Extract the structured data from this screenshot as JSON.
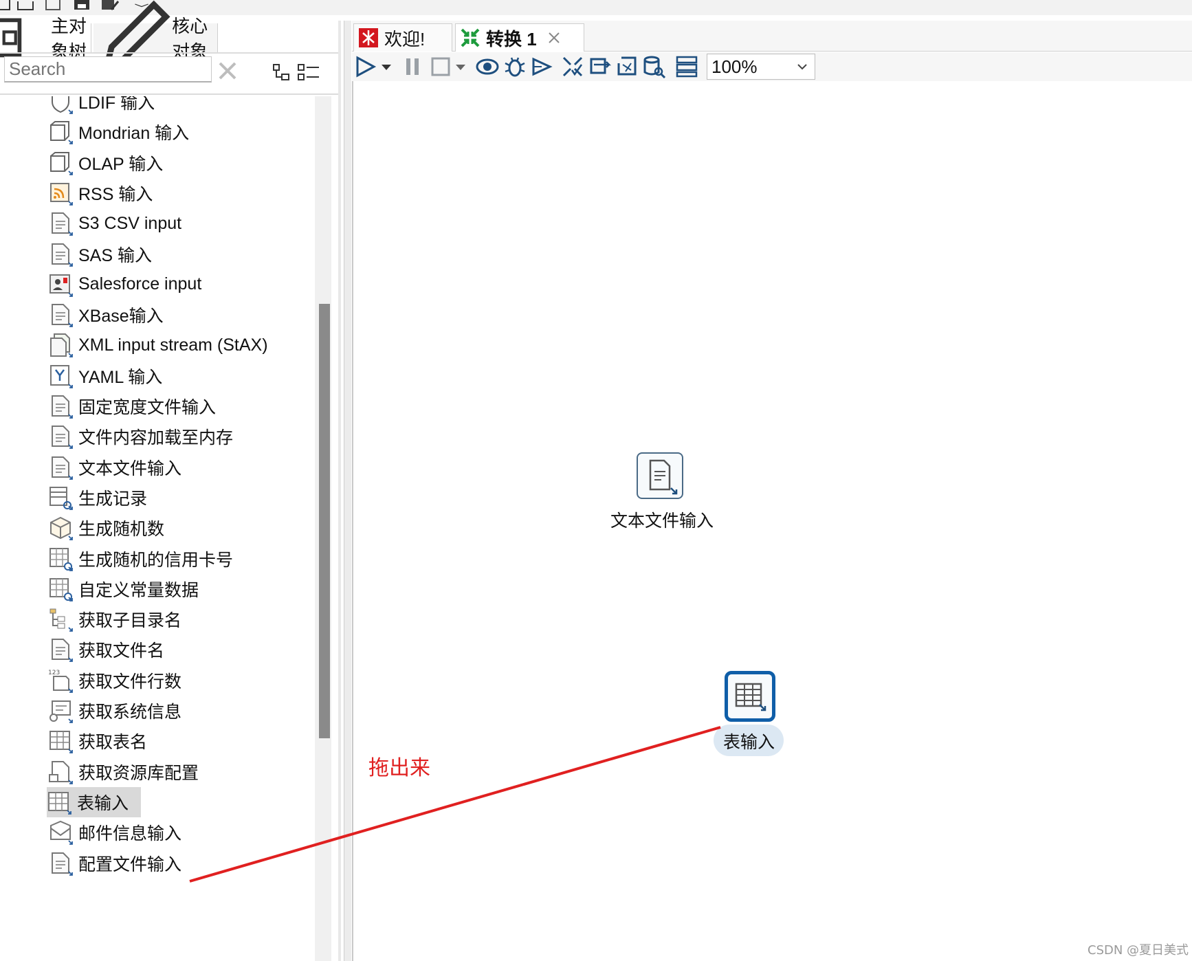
{
  "left_panel": {
    "tabs": [
      {
        "label": "主对象树",
        "icon": "tree-icon"
      },
      {
        "label": "核心对象",
        "icon": "pencil-icon"
      }
    ],
    "search": {
      "placeholder": "Search",
      "value": ""
    },
    "tree_items": [
      {
        "label": "LDIF 输入",
        "icon": "ldif-icon"
      },
      {
        "label": "Mondrian 输入",
        "icon": "cube-icon"
      },
      {
        "label": "OLAP 输入",
        "icon": "cube-icon"
      },
      {
        "label": "RSS 输入",
        "icon": "rss-icon"
      },
      {
        "label": "S3 CSV input",
        "icon": "s3-file-icon"
      },
      {
        "label": "SAS 输入",
        "icon": "sas-file-icon"
      },
      {
        "label": "Salesforce input",
        "icon": "salesforce-icon"
      },
      {
        "label": "XBase输入",
        "icon": "dbf-file-icon"
      },
      {
        "label": "XML input stream (StAX)",
        "icon": "xml-file-icon"
      },
      {
        "label": "YAML 输入",
        "icon": "yaml-icon"
      },
      {
        "label": "固定宽度文件输入",
        "icon": "file-icon"
      },
      {
        "label": "文件内容加载至内存",
        "icon": "file-icon"
      },
      {
        "label": "文本文件输入",
        "icon": "file-icon"
      },
      {
        "label": "生成记录",
        "icon": "generate-rows-icon"
      },
      {
        "label": "生成随机数",
        "icon": "dice-icon"
      },
      {
        "label": "生成随机的信用卡号",
        "icon": "credit-card-icon"
      },
      {
        "label": "自定义常量数据",
        "icon": "table-gear-icon"
      },
      {
        "label": "获取子目录名",
        "icon": "folder-tree-icon"
      },
      {
        "label": "获取文件名",
        "icon": "file-icon"
      },
      {
        "label": "获取文件行数",
        "icon": "file-rows-icon"
      },
      {
        "label": "获取系统信息",
        "icon": "system-info-icon"
      },
      {
        "label": "获取表名",
        "icon": "table-icon"
      },
      {
        "label": "获取资源库配置",
        "icon": "repository-icon"
      },
      {
        "label": "表输入",
        "icon": "table-icon",
        "selected": true
      },
      {
        "label": "邮件信息输入",
        "icon": "mail-icon"
      },
      {
        "label": "配置文件输入",
        "icon": "config-file-icon"
      }
    ]
  },
  "editor": {
    "tabs": [
      {
        "label": "欢迎!",
        "icon": "welcome-icon",
        "active": false
      },
      {
        "label": "转换 1",
        "icon": "transformation-icon",
        "active": true,
        "closable": true
      }
    ],
    "zoom": "100%",
    "canvas_steps": [
      {
        "label": "文本文件输入",
        "icon": "text-file-input-icon",
        "selected": false
      },
      {
        "label": "表输入",
        "icon": "table-input-icon",
        "selected": true
      }
    ],
    "annotation": {
      "text": "拖出来",
      "color": "#e02020"
    }
  },
  "watermark": "CSDN @夏日美式",
  "colors": {
    "selection_border": "#0f5ea8",
    "annotation_line": "#e02020"
  }
}
